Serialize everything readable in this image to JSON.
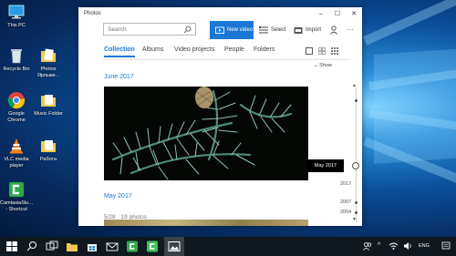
{
  "desktop": {
    "icons": [
      {
        "label": "This PC"
      },
      {
        "label": "Recycle Bin"
      },
      {
        "label": "Photos Ярлыки..."
      },
      {
        "label": "Google Chrome"
      },
      {
        "label": "Music Folder"
      },
      {
        "label": "VLC media player"
      },
      {
        "label": "Работа"
      },
      {
        "label": "CamtasiaStu... - Shortcut"
      }
    ]
  },
  "window": {
    "title": "Photos",
    "search": {
      "placeholder": "Search",
      "value": ""
    },
    "toolbar": {
      "new_video": "New video",
      "select": "Select",
      "import": "Import"
    },
    "tabs": [
      "Collection",
      "Albums",
      "Video projects",
      "People",
      "Folders"
    ],
    "active_tab": "Collection",
    "show_label": "Show",
    "sections": [
      {
        "title": "June 2017"
      },
      {
        "title": "May 2017",
        "date": "5/28",
        "count": "19 photos"
      }
    ],
    "timeline": {
      "tooltip": "May 2017",
      "years": [
        "2017",
        "2007",
        "2004"
      ]
    }
  },
  "taskbar": {
    "lang": "ENG",
    "apps": [
      "start",
      "search",
      "task-view",
      "file-explorer",
      "store",
      "mail",
      "camtasia",
      "camtasia-recorder",
      "photos"
    ]
  },
  "colors": {
    "accent": "#1a78d6",
    "taskbar": "#101820"
  }
}
